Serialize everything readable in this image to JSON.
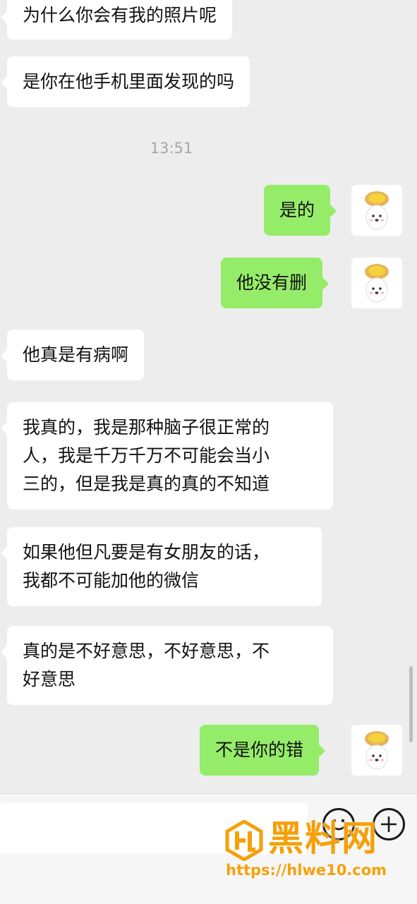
{
  "messages": [
    {
      "side": "in",
      "text": "为什么你会有我的照片呢"
    },
    {
      "side": "in",
      "text": "是你在他手机里面发现的吗"
    },
    {
      "side": "out",
      "text": "是的"
    },
    {
      "side": "out",
      "text": "他没有删"
    },
    {
      "side": "in",
      "text": "他真是有病啊"
    },
    {
      "side": "in",
      "lines": [
        "我真的，我是那种脑子很正常的",
        "人，我是千万千万不可能会当小",
        "三的，但是我是真的真的不知道"
      ]
    },
    {
      "side": "in",
      "lines": [
        "如果他但凡要是有女朋友的话，",
        "我都不可能加他的微信"
      ]
    },
    {
      "side": "in",
      "lines": [
        "真的是不好意思，不好意思，不",
        "好意思"
      ]
    },
    {
      "side": "out",
      "text": "不是你的错"
    }
  ],
  "timestamp": "13:51",
  "watermark": {
    "brand": "黑料网",
    "url": "https://hlwe10.com"
  },
  "colors": {
    "outgoing": "#95ec69",
    "incoming": "#ffffff",
    "background": "#ededed",
    "watermark": "#f5a00a"
  },
  "icons": {
    "avatar": "egg-tart-puppy-avatar-icon",
    "emoji": "emoji-icon",
    "add": "plus-icon"
  }
}
